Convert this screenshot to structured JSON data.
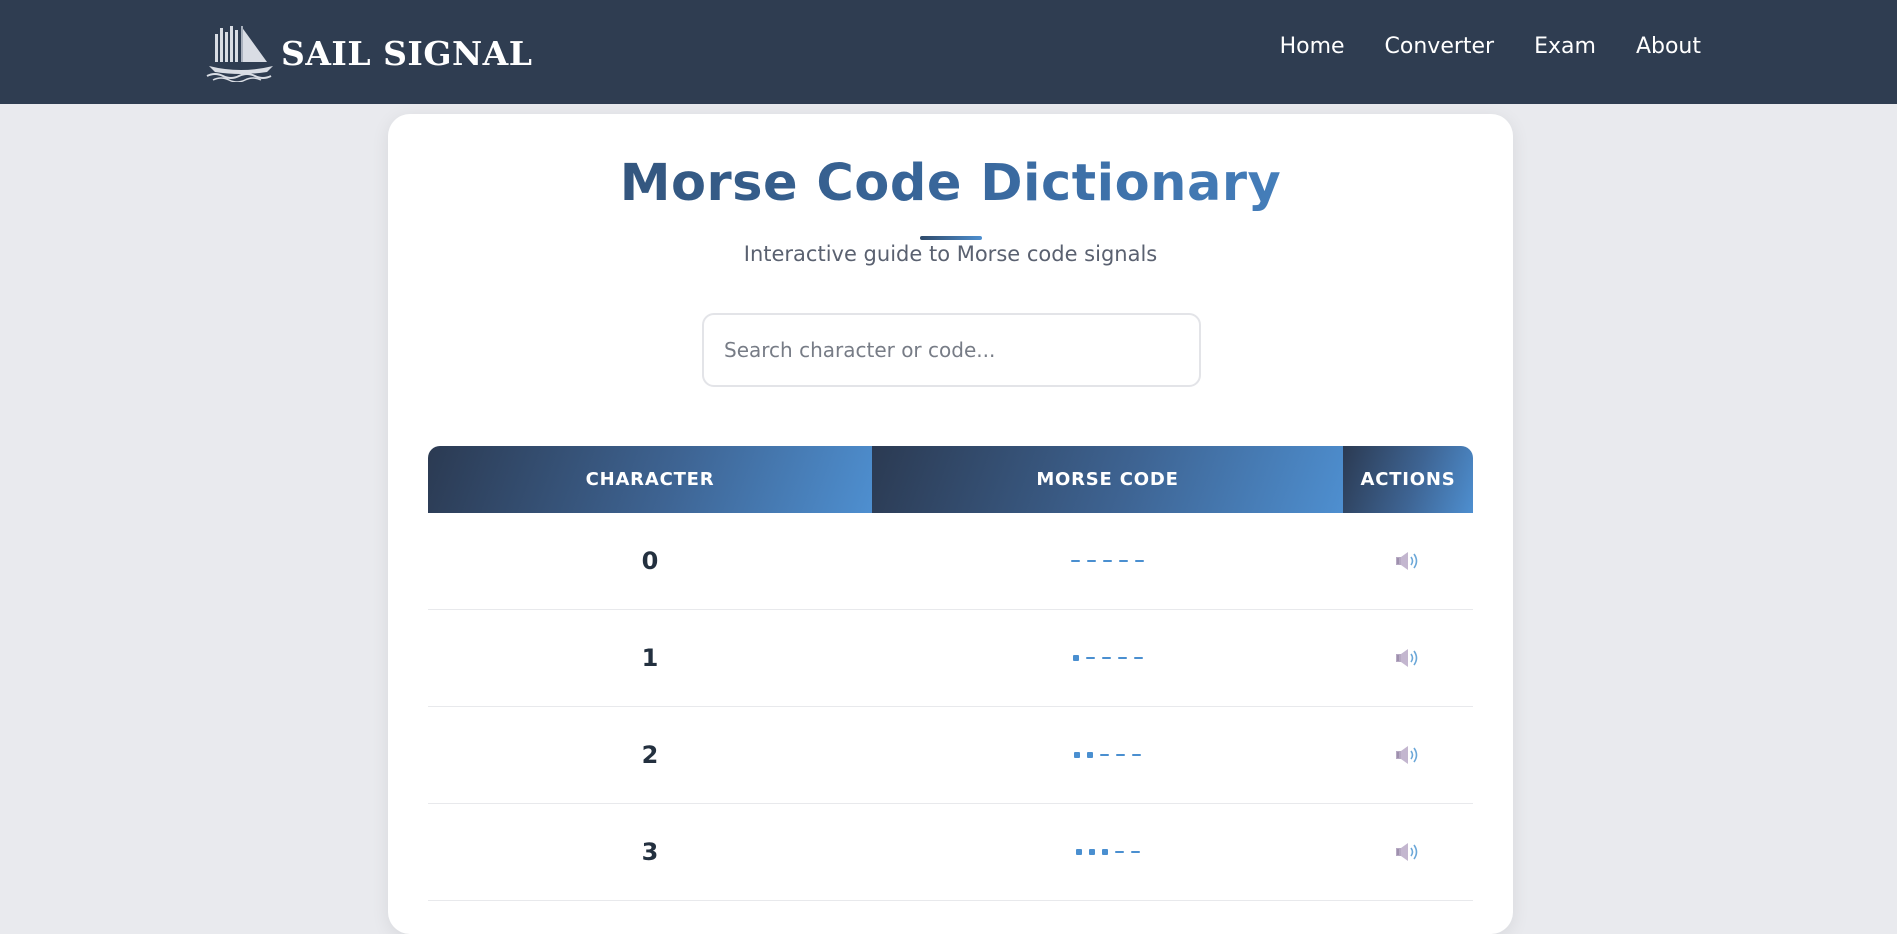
{
  "brand": {
    "name": "SAIL SIGNAL"
  },
  "nav": {
    "links": [
      {
        "label": "Home"
      },
      {
        "label": "Converter"
      },
      {
        "label": "Exam"
      },
      {
        "label": "About"
      }
    ]
  },
  "page": {
    "title": "Morse Code Dictionary",
    "subtitle": "Interactive guide to Morse code signals"
  },
  "search": {
    "placeholder": "Search character or code...",
    "value": ""
  },
  "table": {
    "headers": {
      "character": "CHARACTER",
      "morse": "MORSE CODE",
      "actions": "ACTIONS"
    },
    "rows": [
      {
        "character": "0",
        "code": "-----"
      },
      {
        "character": "1",
        "code": ".----"
      },
      {
        "character": "2",
        "code": "..---"
      },
      {
        "character": "3",
        "code": "...--"
      }
    ],
    "action_icon": "speaker-icon"
  },
  "colors": {
    "navbar": "#2f3d51",
    "accent": "#4a8fd0",
    "background": "#e9eaee",
    "text_dark": "#23303f"
  }
}
